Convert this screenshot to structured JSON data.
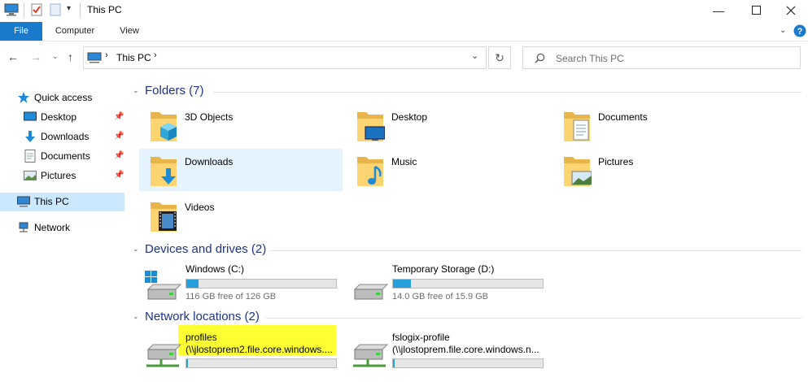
{
  "window": {
    "title": "This PC"
  },
  "ribbon": {
    "tabs": [
      "File",
      "Computer",
      "View"
    ]
  },
  "address": {
    "location": "This PC",
    "search_placeholder": "Search This PC"
  },
  "nav_pane": {
    "quick_access": "Quick access",
    "items": [
      {
        "label": "Desktop",
        "icon": "desktop-icon"
      },
      {
        "label": "Downloads",
        "icon": "downloads-icon"
      },
      {
        "label": "Documents",
        "icon": "documents-icon"
      },
      {
        "label": "Pictures",
        "icon": "pictures-icon"
      }
    ],
    "this_pc": "This PC",
    "network": "Network"
  },
  "folders": {
    "heading": "Folders (7)",
    "items": [
      {
        "label": "3D Objects"
      },
      {
        "label": "Desktop"
      },
      {
        "label": "Documents"
      },
      {
        "label": "Downloads"
      },
      {
        "label": "Music"
      },
      {
        "label": "Pictures"
      },
      {
        "label": "Videos"
      }
    ]
  },
  "devices": {
    "heading": "Devices and drives (2)",
    "items": [
      {
        "name": "Windows (C:)",
        "free": "116 GB free of 126 GB",
        "used_fraction": 0.08
      },
      {
        "name": "Temporary Storage (D:)",
        "free": "14.0 GB free of 15.9 GB",
        "used_fraction": 0.12
      }
    ]
  },
  "network_locations": {
    "heading": "Network locations (2)",
    "items": [
      {
        "name": "profiles",
        "path": "(\\\\jlostoprem2.file.core.windows....",
        "used_fraction": 0.01
      },
      {
        "name": "fslogix-profile",
        "path": "(\\\\jlostoprem.file.core.windows.n...",
        "used_fraction": 0.01
      }
    ]
  },
  "colors": {
    "accent": "#1979ca",
    "heading": "#1e3287",
    "bar_fill": "#26a0da",
    "highlight": "#fdff32",
    "selection": "#e5f3ff"
  }
}
